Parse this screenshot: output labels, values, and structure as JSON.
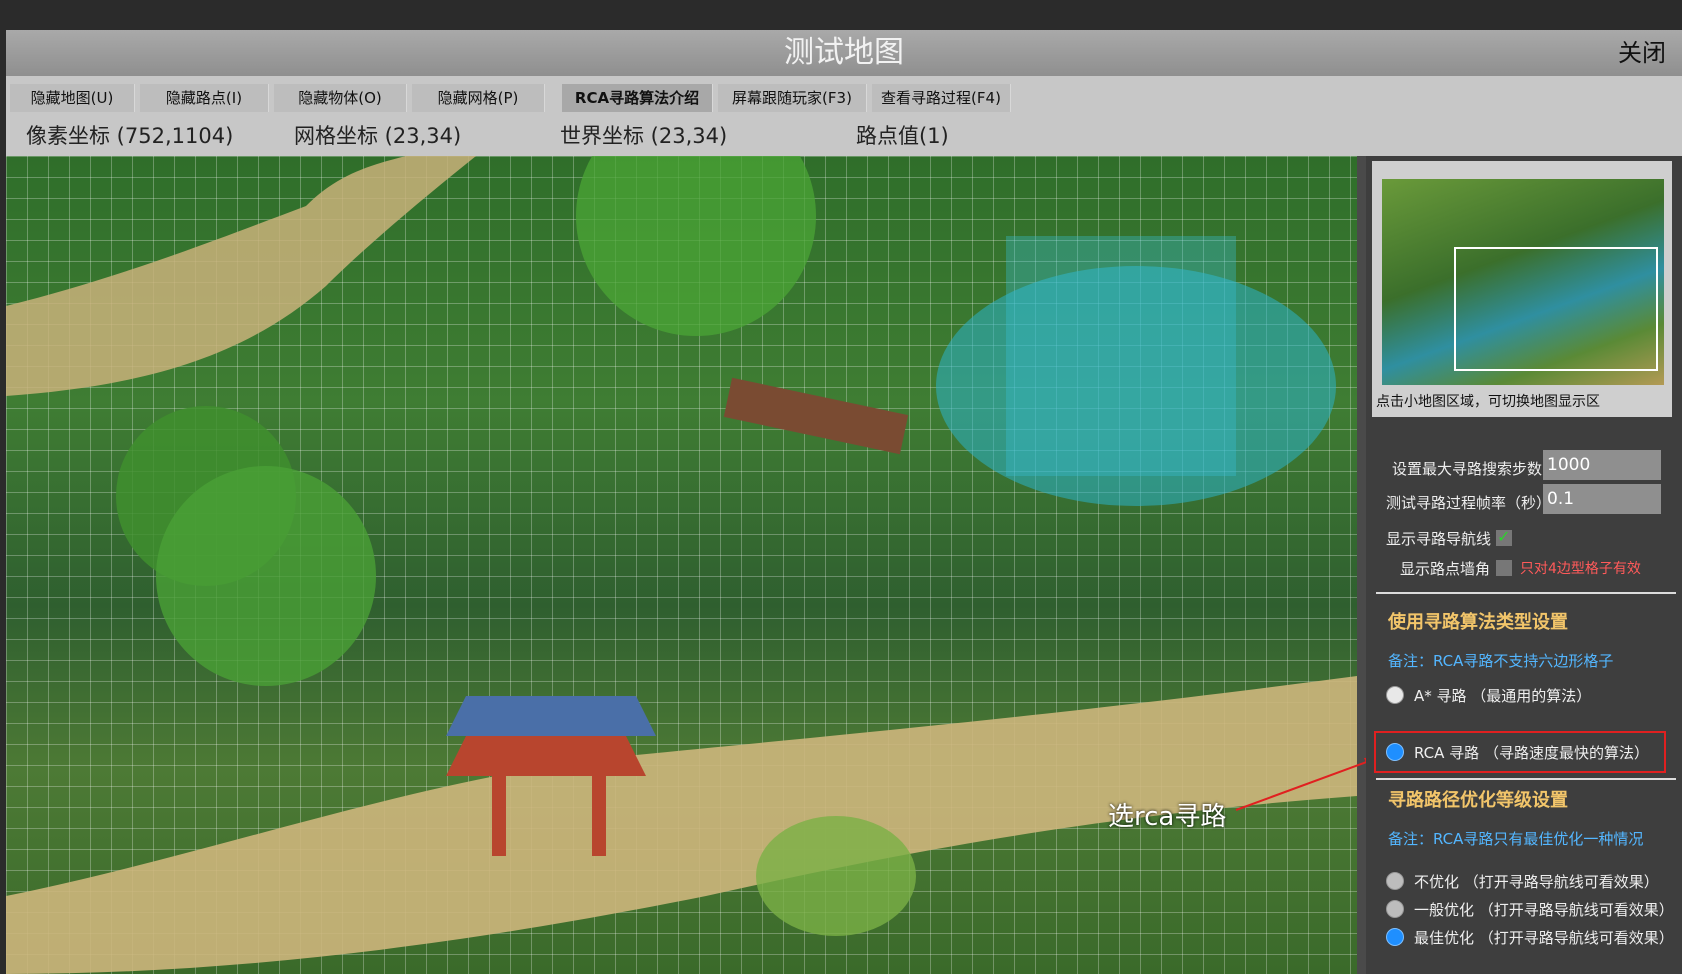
{
  "window": {
    "title": "测试地图",
    "close_label": "关闭"
  },
  "toolbar": {
    "buttons": [
      {
        "label": "隐藏地图(U)"
      },
      {
        "label": "隐藏路点(I)"
      },
      {
        "label": "隐藏物体(O)"
      },
      {
        "label": "隐藏网格(P)"
      },
      {
        "label": "RCA寻路算法介绍",
        "active": true
      },
      {
        "label": "屏幕跟随玩家(F3)"
      },
      {
        "label": "查看寻路过程(F4)"
      }
    ]
  },
  "coords": {
    "pixel": "像素坐标 (752,1104)",
    "grid": "网格坐标 (23,34)",
    "world": "世界坐标 (23,34)",
    "waypoint": "路点值(1)"
  },
  "map": {
    "annotation": "选rca寻路"
  },
  "panel": {
    "minimap_hint": "点击小地图区域，可切换地图显示区",
    "max_steps_label": "设置最大寻路搜索步数",
    "max_steps_value": "1000",
    "frame_rate_label": "测试寻路过程帧率（秒）",
    "frame_rate_value": "0.1",
    "show_nav_label": "显示寻路导航线",
    "show_nav_checked": true,
    "show_corner_label": "显示路点墙角",
    "show_corner_checked": false,
    "corner_note": "只对4边型格子有效",
    "algo_section": "使用寻路算法类型设置",
    "algo_note": "备注：RCA寻路不支持六边形格子",
    "algo_options": [
      {
        "label": "A* 寻路 （最通用的算法）",
        "selected": false
      },
      {
        "label": "RCA 寻路 （寻路速度最快的算法）",
        "selected": true
      }
    ],
    "optimize_section": "寻路路径优化等级设置",
    "optimize_note": "备注：RCA寻路只有最佳优化一种情况",
    "optimize_options": [
      {
        "label": "不优化 （打开寻路导航线可看效果）",
        "selected": false
      },
      {
        "label": "一般优化 （打开寻路导航线可看效果）",
        "selected": false
      },
      {
        "label": "最佳优化 （打开寻路导航线可看效果）",
        "selected": true
      }
    ]
  },
  "colors": {
    "accent_blue": "#1f8fff",
    "section_title": "#f2c56a",
    "note_blue": "#53b6ff",
    "warning_red": "#ff5a5a",
    "highlight_red": "#e02020"
  }
}
